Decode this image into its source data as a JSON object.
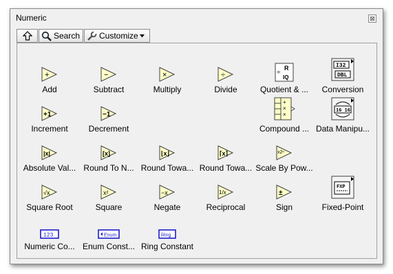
{
  "window": {
    "title": "Numeric",
    "close_glyph": "⊠"
  },
  "toolbar": {
    "up_label": "",
    "search_label": "Search",
    "customize_label": "Customize"
  },
  "palette": {
    "items": [
      {
        "label": "Add",
        "icon": "add-icon"
      },
      {
        "label": "Subtract",
        "icon": "subtract-icon"
      },
      {
        "label": "Multiply",
        "icon": "multiply-icon"
      },
      {
        "label": "Divide",
        "icon": "divide-icon"
      },
      {
        "label": "Quotient & ...",
        "icon": "quotient-remainder-icon"
      },
      {
        "label": "Conversion",
        "icon": "conversion-icon"
      },
      {
        "label": "Increment",
        "icon": "increment-icon"
      },
      {
        "label": "Decrement",
        "icon": "decrement-icon"
      },
      {
        "label": "Compound ...",
        "icon": "compound-arithmetic-icon"
      },
      {
        "label": "Data Manipu...",
        "icon": "data-manipulation-icon"
      },
      {
        "label": "Absolute Val...",
        "icon": "absolute-value-icon"
      },
      {
        "label": "Round To N...",
        "icon": "round-to-nearest-icon"
      },
      {
        "label": "Round Towa...",
        "icon": "round-toward-neg-infinity-icon"
      },
      {
        "label": "Round Towa...",
        "icon": "round-toward-pos-infinity-icon"
      },
      {
        "label": "Scale By Pow...",
        "icon": "scale-by-power-of-2-icon"
      },
      {
        "label": "Square Root",
        "icon": "square-root-icon"
      },
      {
        "label": "Square",
        "icon": "square-icon"
      },
      {
        "label": "Negate",
        "icon": "negate-icon"
      },
      {
        "label": "Reciprocal",
        "icon": "reciprocal-icon"
      },
      {
        "label": "Sign",
        "icon": "sign-icon"
      },
      {
        "label": "Fixed-Point",
        "icon": "fixed-point-icon"
      },
      {
        "label": "Numeric Co...",
        "icon": "numeric-constant-icon"
      },
      {
        "label": "Enum Const...",
        "icon": "enum-constant-icon"
      },
      {
        "label": "Ring Constant",
        "icon": "ring-constant-icon"
      }
    ],
    "glyphs": {
      "add": "+",
      "subtract": "−",
      "multiply": "×",
      "divide": "÷",
      "increment": "+1",
      "decrement": "−1",
      "abs": "|x|",
      "round_nearest": "[x]",
      "round_down": "⌊x⌋",
      "round_up": "⌈x⌉",
      "scale": "x2ⁿ",
      "sqrt": "√x",
      "square": "x²",
      "negate": "−x",
      "reciprocal": "1/x",
      "sign": "±",
      "quotient_r": "R",
      "quotient_iq": "IQ",
      "conv_top": "I32",
      "conv_bottom": "DBL",
      "dm_text": "16 16",
      "fxp": "FXP",
      "numeric_const": "123",
      "enum_const": "Enum",
      "ring_const": "Ring"
    }
  },
  "colors": {
    "node_fill": "#ffffc8",
    "node_stroke": "#404040",
    "const_blue": "#1c1ccc"
  }
}
